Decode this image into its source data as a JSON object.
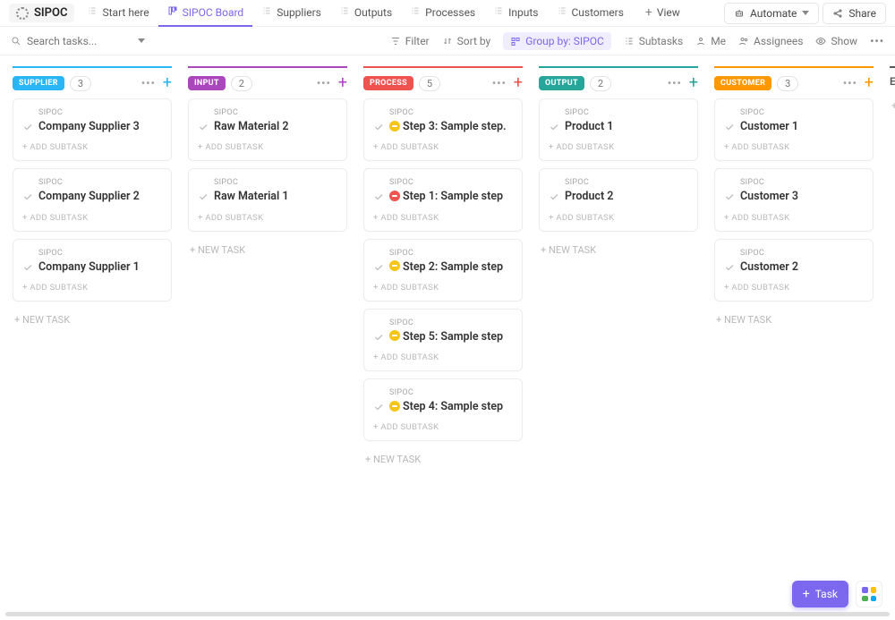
{
  "app_title": "SIPOC",
  "views": [
    {
      "label": "Start here",
      "active": false
    },
    {
      "label": "SIPOC Board",
      "active": true
    },
    {
      "label": "Suppliers",
      "active": false
    },
    {
      "label": "Outputs",
      "active": false
    },
    {
      "label": "Processes",
      "active": false
    },
    {
      "label": "Inputs",
      "active": false
    },
    {
      "label": "Customers",
      "active": false
    }
  ],
  "add_view_label": "View",
  "top_actions": {
    "automate": "Automate",
    "share": "Share"
  },
  "toolbar": {
    "search_placeholder": "Search tasks...",
    "filter": "Filter",
    "sort": "Sort by",
    "group": "Group by: SIPOC",
    "subtasks": "Subtasks",
    "me": "Me",
    "assignees": "Assignees",
    "show": "Show"
  },
  "crumb": "SIPOC",
  "add_subtask": "+ ADD SUBTASK",
  "new_task": "+ NEW TASK",
  "fab_task": "Task",
  "columns": [
    {
      "name": "SUPPLIER",
      "count": "3",
      "pill_bg": "#29b6f6",
      "bar": "#29b6f6",
      "plus": "#29b6f6",
      "cards": [
        {
          "title": "Company Supplier 3",
          "priority": null
        },
        {
          "title": "Company Supplier 2",
          "priority": null
        },
        {
          "title": "Company Supplier 1",
          "priority": null
        }
      ]
    },
    {
      "name": "INPUT",
      "count": "2",
      "pill_bg": "#ab47bc",
      "bar": "#ab47bc",
      "plus": "#ab47bc",
      "cards": [
        {
          "title": "Raw Material 2",
          "priority": null
        },
        {
          "title": "Raw Material 1",
          "priority": null
        }
      ]
    },
    {
      "name": "PROCESS",
      "count": "5",
      "pill_bg": "#ef5350",
      "bar": "#ef5350",
      "plus": "#ef5350",
      "cards": [
        {
          "title": "Step 3: Sample step.",
          "priority": "yellow"
        },
        {
          "title": "Step 1: Sample step",
          "priority": "red"
        },
        {
          "title": "Step 2: Sample step",
          "priority": "yellow"
        },
        {
          "title": "Step 5: Sample step",
          "priority": "yellow"
        },
        {
          "title": "Step 4: Sample step",
          "priority": "yellow"
        }
      ]
    },
    {
      "name": "OUTPUT",
      "count": "2",
      "pill_bg": "#26a69a",
      "bar": "#26a69a",
      "plus": "#26a69a",
      "cards": [
        {
          "title": "Product 1",
          "priority": null
        },
        {
          "title": "Product 2",
          "priority": null
        }
      ]
    },
    {
      "name": "CUSTOMER",
      "count": "3",
      "pill_bg": "#ff9800",
      "bar": "#ff9800",
      "plus": "#ff9800",
      "cards": [
        {
          "title": "Customer 1",
          "priority": null
        },
        {
          "title": "Customer 3",
          "priority": null
        },
        {
          "title": "Customer 2",
          "priority": null
        }
      ]
    }
  ],
  "trailing_column": {
    "label": "Empty",
    "new_hint": "+ NE"
  }
}
